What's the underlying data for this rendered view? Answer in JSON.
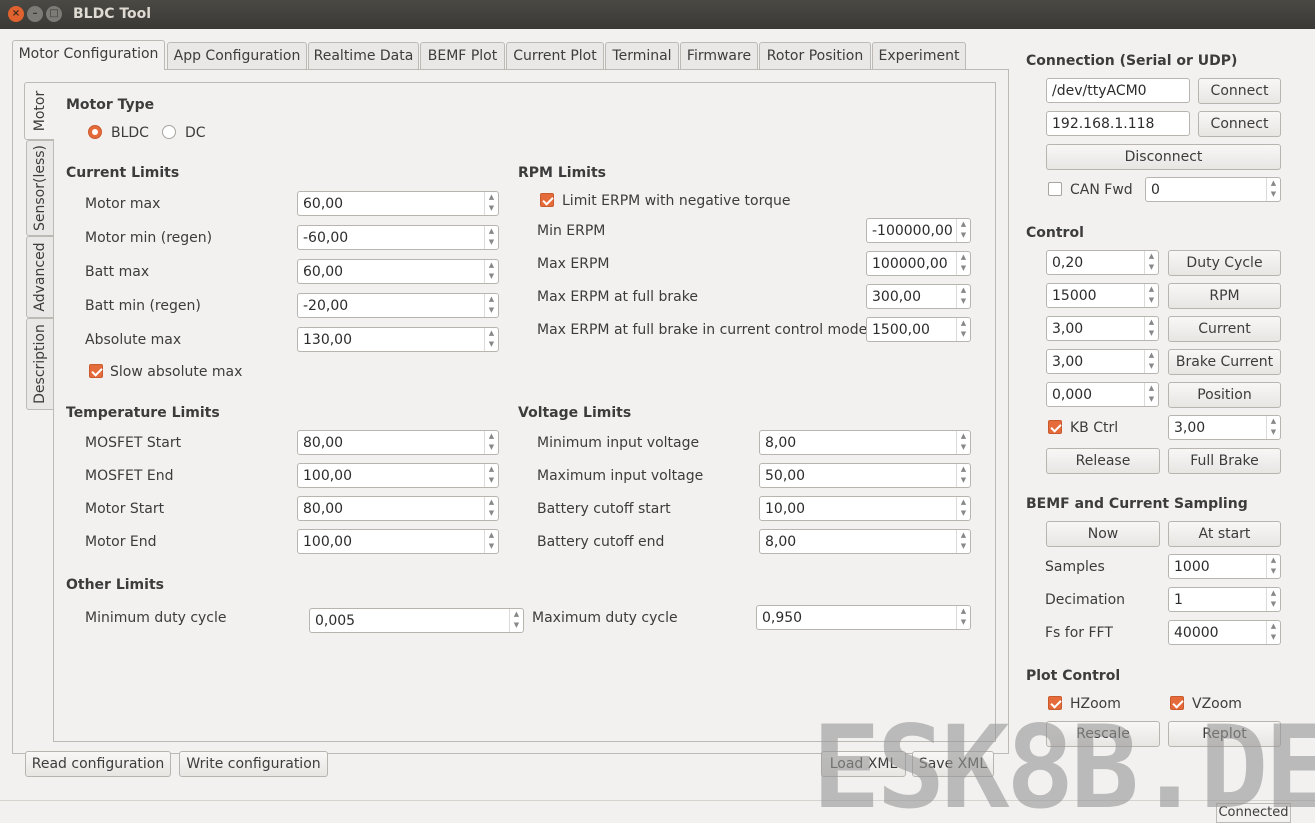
{
  "window": {
    "title": "BLDC Tool"
  },
  "tabs": [
    "Motor Configuration",
    "App Configuration",
    "Realtime Data",
    "BEMF Plot",
    "Current Plot",
    "Terminal",
    "Firmware",
    "Rotor Position",
    "Experiment"
  ],
  "vtabs": [
    "Motor",
    "Sensor(less)",
    "Advanced",
    "Description"
  ],
  "motor_type": {
    "title": "Motor Type",
    "options": [
      "BLDC",
      "DC"
    ],
    "selected": "BLDC"
  },
  "current_limits": {
    "title": "Current Limits",
    "rows": [
      {
        "label": "Motor max",
        "value": "60,00"
      },
      {
        "label": "Motor min (regen)",
        "value": "-60,00"
      },
      {
        "label": "Batt max",
        "value": "60,00"
      },
      {
        "label": "Batt min (regen)",
        "value": "-20,00"
      },
      {
        "label": "Absolute max",
        "value": "130,00"
      }
    ],
    "slow_abs_label": "Slow absolute max"
  },
  "rpm_limits": {
    "title": "RPM Limits",
    "neg_torque_label": "Limit ERPM with negative torque",
    "rows": [
      {
        "label": "Min ERPM",
        "value": "-100000,00"
      },
      {
        "label": "Max ERPM",
        "value": "100000,00"
      },
      {
        "label": "Max ERPM at full brake",
        "value": "300,00"
      },
      {
        "label": "Max ERPM at full brake in current control mode",
        "value": "1500,00"
      }
    ]
  },
  "temperature_limits": {
    "title": "Temperature Limits",
    "rows": [
      {
        "label": "MOSFET Start",
        "value": "80,00"
      },
      {
        "label": "MOSFET End",
        "value": "100,00"
      },
      {
        "label": "Motor Start",
        "value": "80,00"
      },
      {
        "label": "Motor End",
        "value": "100,00"
      }
    ]
  },
  "voltage_limits": {
    "title": "Voltage Limits",
    "rows": [
      {
        "label": "Minimum input voltage",
        "value": "8,00"
      },
      {
        "label": "Maximum input voltage",
        "value": "50,00"
      },
      {
        "label": "Battery cutoff start",
        "value": "10,00"
      },
      {
        "label": "Battery cutoff end",
        "value": "8,00"
      }
    ]
  },
  "other_limits": {
    "title": "Other Limits",
    "min_duty_label": "Minimum duty cycle",
    "min_duty_value": "0,005",
    "max_duty_label": "Maximum duty cycle",
    "max_duty_value": "0,950"
  },
  "bottom_buttons": {
    "read": "Read configuration",
    "write": "Write configuration",
    "load": "Load XML",
    "save": "Save XML"
  },
  "connection": {
    "title": "Connection (Serial or UDP)",
    "serial_port": "/dev/ttyACM0",
    "udp_address": "192.168.1.118",
    "connect_label": "Connect",
    "disconnect_label": "Disconnect",
    "can_fwd_label": "CAN Fwd",
    "can_fwd_value": "0"
  },
  "control": {
    "title": "Control",
    "duty_value": "0,20",
    "duty_label": "Duty Cycle",
    "rpm_value": "15000",
    "rpm_label": "RPM",
    "current_value": "3,00",
    "current_label": "Current",
    "brake_value": "3,00",
    "brake_label": "Brake Current",
    "position_value": "0,000",
    "position_label": "Position",
    "kb_label": "KB Ctrl",
    "kb_value": "3,00",
    "release_label": "Release",
    "full_brake_label": "Full Brake"
  },
  "sampling": {
    "title": "BEMF and Current Sampling",
    "now_label": "Now",
    "at_start_label": "At start",
    "samples_label": "Samples",
    "samples_value": "1000",
    "decimation_label": "Decimation",
    "decimation_value": "1",
    "fs_label": "Fs for FFT",
    "fs_value": "40000"
  },
  "plot_control": {
    "title": "Plot Control",
    "hzoom_label": "HZoom",
    "vzoom_label": "VZoom",
    "rescale_label": "Rescale",
    "replot_label": "Replot"
  },
  "status": {
    "text": "Connected"
  },
  "watermark": "ESK8B.DE",
  "colors": {
    "accent": "#e66b3a",
    "titlebar": "#3a3935",
    "background": "#f2f1f0"
  }
}
